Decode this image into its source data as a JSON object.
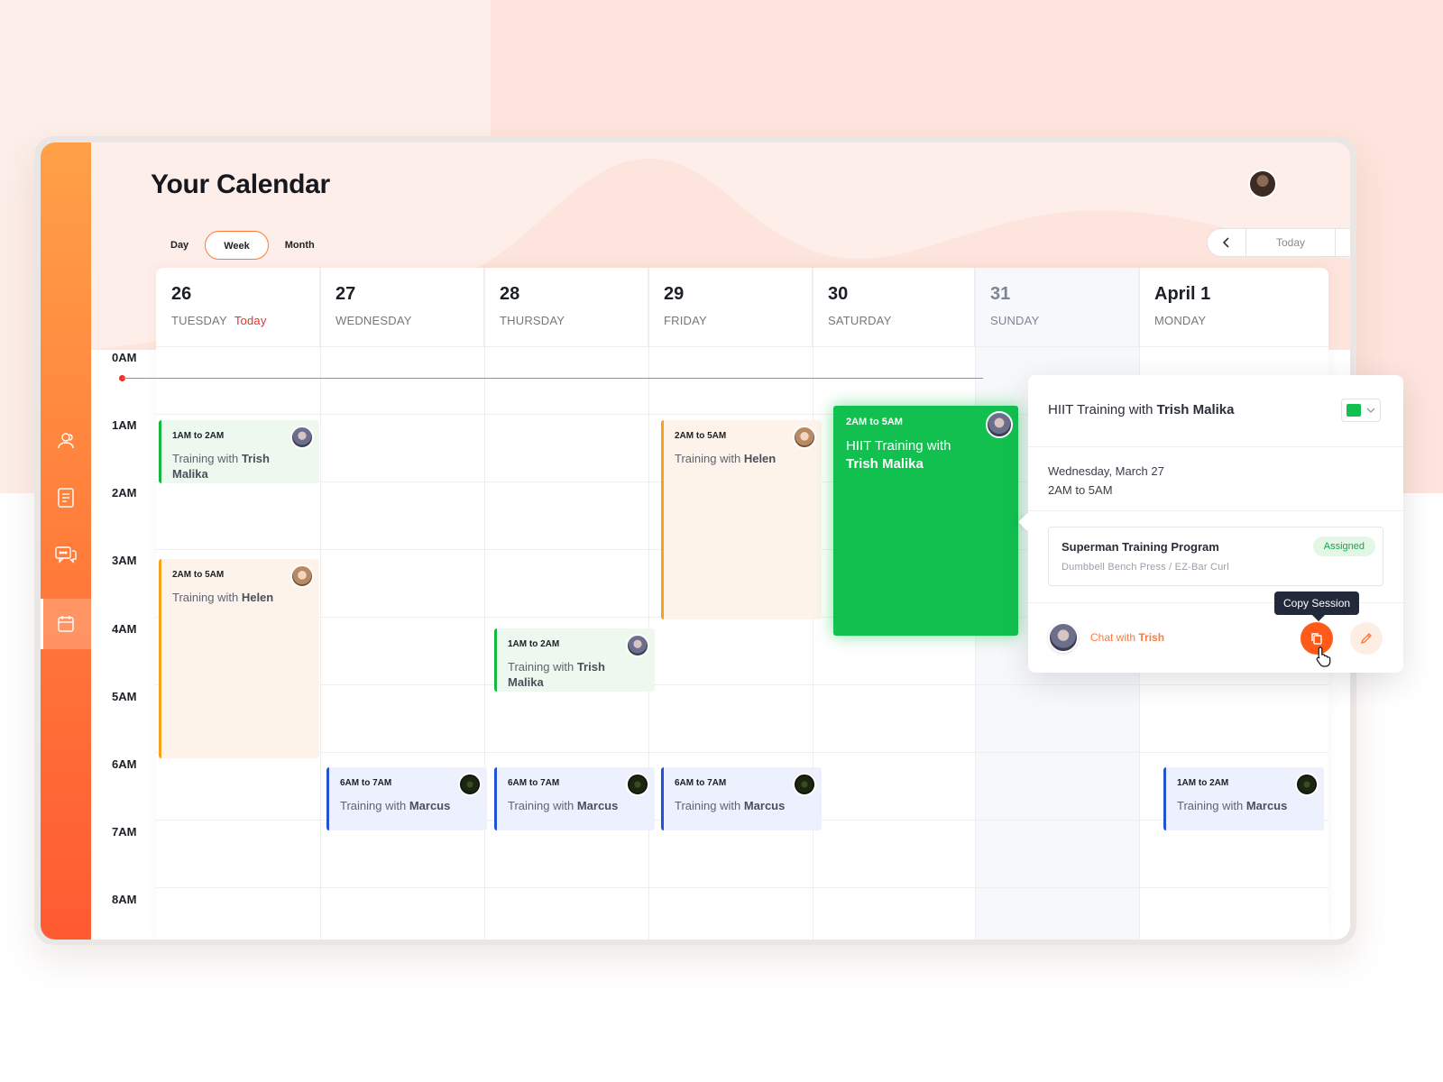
{
  "app": {
    "title": "Your Calendar"
  },
  "colors": {
    "accent": "#ff7a3a",
    "today_red": "#e8322d",
    "green": "#12c04f",
    "orange": "#f7a21b",
    "blue": "#2452d6"
  },
  "sidebar": {
    "items": [
      {
        "icon": "users-icon"
      },
      {
        "icon": "document-icon"
      },
      {
        "icon": "chat-icon"
      },
      {
        "icon": "calendar-icon",
        "active": true
      }
    ]
  },
  "views": {
    "day": "Day",
    "week": "Week",
    "month": "Month",
    "selected": "Week"
  },
  "nav": {
    "prev": "‹",
    "today": "Today",
    "next": "›"
  },
  "days": [
    {
      "num": "26",
      "name": "TUESDAY",
      "badge": "Today"
    },
    {
      "num": "27",
      "name": "WEDNESDAY"
    },
    {
      "num": "28",
      "name": "THURSDAY"
    },
    {
      "num": "29",
      "name": "FRIDAY"
    },
    {
      "num": "30",
      "name": "SATURDAY"
    },
    {
      "num": "31",
      "name": "SUNDAY"
    },
    {
      "num": "April 1",
      "name": "MONDAY"
    }
  ],
  "hours": [
    "0AM",
    "1AM",
    "2AM",
    "3AM",
    "4AM",
    "5AM",
    "6AM",
    "7AM",
    "8AM"
  ],
  "events": [
    {
      "time": "1AM to 2AM",
      "title_pre": "Training with ",
      "title_bold": "Trish Malika"
    },
    {
      "time": "2AM to 5AM",
      "title_pre": "Training with ",
      "title_bold": "Helen"
    },
    {
      "time": "1AM to 2AM",
      "title_pre": "Training with ",
      "title_bold": "Trish Malika"
    },
    {
      "time": "2AM to 5AM",
      "title_pre": "Training with ",
      "title_bold": "Helen"
    },
    {
      "time": "6AM to 7AM",
      "title_pre": "Training with ",
      "title_bold": "Marcus"
    },
    {
      "time": "6AM to 7AM",
      "title_pre": "Training with ",
      "title_bold": "Marcus"
    },
    {
      "time": "6AM to 7AM",
      "title_pre": "Training with ",
      "title_bold": "Marcus"
    },
    {
      "time": "1AM to 2AM",
      "title_pre": "Training with ",
      "title_bold": "Marcus"
    },
    {
      "time": "2AM to 5AM",
      "title_pre": "HIIT Training with ",
      "title_bold": "Trish Malika"
    }
  ],
  "popover": {
    "title_pre": "HIIT Training with ",
    "title_bold": "Trish Malika",
    "color": "#12c04f",
    "date": "Wednesday, March 27",
    "time": "2AM to 5AM",
    "program": {
      "name": "Superman Training Program",
      "exercises": "Dumbbell Bench Press / EZ-Bar Curl",
      "status": "Assigned"
    },
    "chat_pre": "Chat with ",
    "chat_bold": "Trish",
    "tooltip": "Copy Session"
  }
}
